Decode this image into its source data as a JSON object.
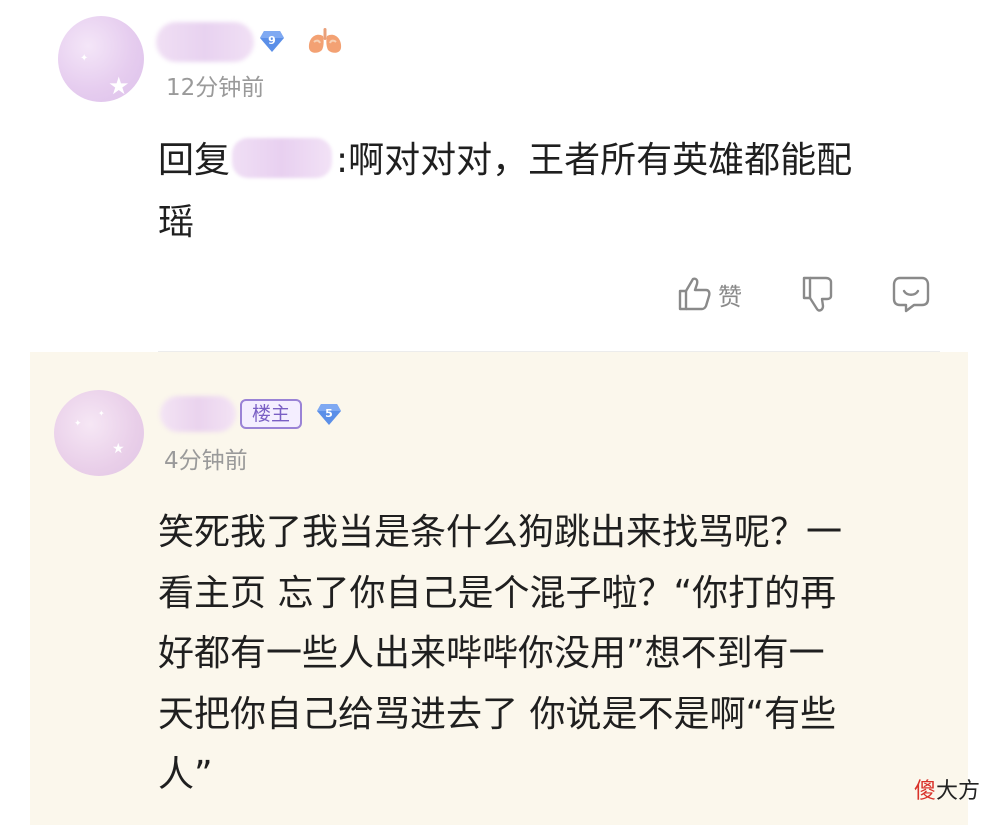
{
  "comments": [
    {
      "author_level": "9",
      "timestamp": "12分钟前",
      "text_prefix": "回复",
      "text_line1_suffix": ":啊对对对，王者所有英雄都能配",
      "text_line2": "瑶",
      "actions": {
        "like_label": "赞",
        "like_icon": "thumbs-up-icon",
        "dislike_icon": "thumbs-down-icon",
        "reply_icon": "comment-bubble-icon"
      }
    },
    {
      "author_tag": "楼主",
      "author_level": "5",
      "timestamp": "4分钟前",
      "text_lines": [
        "笑死我了我当是条什么狗跳出来找骂呢？一",
        "看主页 忘了你自己是个混子啦？“你打的再",
        "好都有一些人出来哔哔你没用”想不到有一",
        "天把你自己给骂进去了 你说是不是啊“有些",
        "人”"
      ]
    }
  ],
  "watermark": {
    "part1": "傻",
    "part2": "大方"
  },
  "colors": {
    "highlight_background": "#fbf7ec",
    "host_tag": "#7a5fc4",
    "level_badge": "#5b8fe8",
    "timestamp": "#9a9a9a"
  }
}
